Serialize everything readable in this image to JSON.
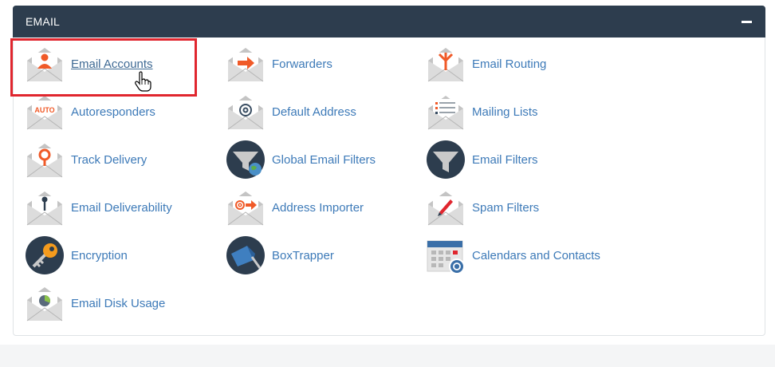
{
  "panel": {
    "title": "EMAIL"
  },
  "items": [
    {
      "label": "Email Accounts",
      "icon": "envelope-user-icon"
    },
    {
      "label": "Forwarders",
      "icon": "envelope-arrow-icon"
    },
    {
      "label": "Email Routing",
      "icon": "envelope-routing-icon"
    },
    {
      "label": "Autoresponders",
      "icon": "envelope-auto-icon"
    },
    {
      "label": "Default Address",
      "icon": "envelope-at-icon"
    },
    {
      "label": "Mailing Lists",
      "icon": "envelope-list-icon"
    },
    {
      "label": "Track Delivery",
      "icon": "envelope-pin-icon"
    },
    {
      "label": "Global Email Filters",
      "icon": "funnel-globe-icon"
    },
    {
      "label": "Email Filters",
      "icon": "funnel-icon"
    },
    {
      "label": "Email Deliverability",
      "icon": "envelope-key-icon"
    },
    {
      "label": "Address Importer",
      "icon": "envelope-at-arrow-icon"
    },
    {
      "label": "Spam Filters",
      "icon": "envelope-pen-icon"
    },
    {
      "label": "Encryption",
      "icon": "key-icon"
    },
    {
      "label": "BoxTrapper",
      "icon": "boxtrapper-icon"
    },
    {
      "label": "Calendars and Contacts",
      "icon": "calendar-at-icon"
    },
    {
      "label": "Email Disk Usage",
      "icon": "envelope-pie-icon"
    }
  ],
  "active_item": "Email Accounts",
  "auto_badge_text": "AUTO",
  "colors": {
    "header": "#2d3d4e",
    "link": "#3d7ab8",
    "accent": "#f05a28",
    "highlight": "#e0262e"
  }
}
